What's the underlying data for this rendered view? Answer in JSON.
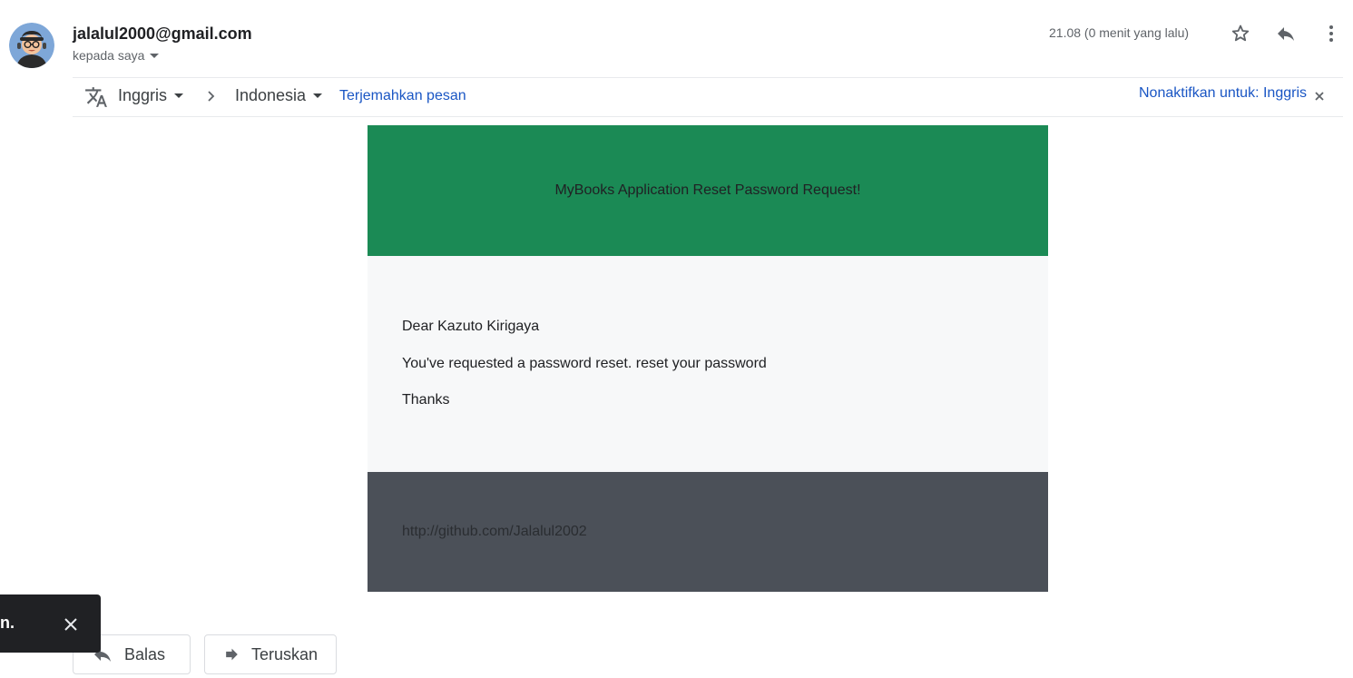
{
  "header": {
    "sender_email": "jalalul2000@gmail.com",
    "recipient_label": "kepada saya",
    "timestamp": "21.08 (0 menit yang lalu)",
    "icons": [
      "avatar",
      "star-icon",
      "reply-icon",
      "more-vert-icon"
    ]
  },
  "translate_bar": {
    "icon": "translate-icon",
    "source_lang": "Inggris",
    "target_lang": "Indonesia",
    "translate_link": "Terjemahkan pesan",
    "disable_link": "Nonaktifkan untuk: Inggris"
  },
  "email": {
    "header_text": "MyBooks Application Reset Password Request!",
    "greeting": "Dear Kazuto Kirigaya",
    "body_line": "You've requested a password reset. reset your password",
    "closing": "Thanks",
    "footer_link": "http://github.com/Jalalul2002",
    "colors": {
      "header_bg": "#1b8a55",
      "body_bg": "#f7f8f9",
      "footer_bg": "#4b5058"
    }
  },
  "actions": {
    "reply_label": "Balas",
    "forward_label": "Teruskan"
  },
  "snackbar": {
    "text": "n."
  }
}
